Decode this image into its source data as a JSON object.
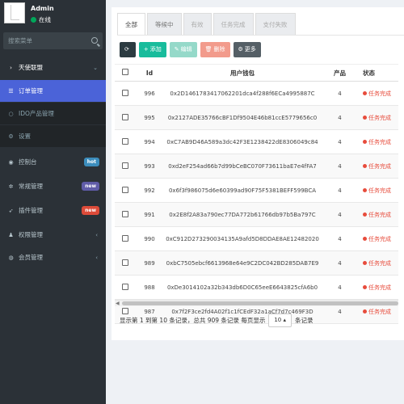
{
  "user": {
    "name": "Admin",
    "status": "在线"
  },
  "search": {
    "placeholder": "搜索菜单"
  },
  "menu": [
    {
      "label": "天使联盟",
      "icon": "chevron-right-icon",
      "type": "parent",
      "chevron": "⌄"
    },
    {
      "label": "订单管理",
      "icon": "list-icon",
      "type": "active"
    },
    {
      "label": "IDO产品管理",
      "icon": "circle-icon",
      "type": "sub"
    },
    {
      "label": "设置",
      "icon": "gear-icon",
      "type": "sub"
    },
    {
      "label": "控制台",
      "icon": "dashboard-icon",
      "badge": "hot",
      "badge_color": "#3c8dbc"
    },
    {
      "label": "常规管理",
      "icon": "cogs-icon",
      "badge": "new",
      "badge_color": "#605ca8"
    },
    {
      "label": "插件管理",
      "icon": "rocket-icon",
      "badge": "new",
      "badge_color": "#dd4b39"
    },
    {
      "label": "权限管理",
      "icon": "users-icon",
      "chevron": "‹"
    },
    {
      "label": "会员管理",
      "icon": "user-circle-icon",
      "chevron": "‹"
    }
  ],
  "tabs": [
    "全部",
    "等候中",
    "有效",
    "任务完成",
    "支付失败"
  ],
  "toolbar": {
    "refresh_label": "",
    "add_label": "添加",
    "edit_label": "编辑",
    "delete_label": "删除",
    "more_label": "更多"
  },
  "colors": {
    "refresh": "#2c3b41",
    "add": "#18bc9c",
    "edit": "#95d9c9",
    "delete": "#f29b8c",
    "more": "#555f66",
    "status_red": "#e74c3c"
  },
  "table": {
    "headers": [
      "Id",
      "用户钱包",
      "产品",
      "状态"
    ],
    "rows": [
      {
        "id": "996",
        "wallet": "0x2D1461783417062201dca4f288f6ECa4995887C",
        "product": "4",
        "status": "任务完成"
      },
      {
        "id": "995",
        "wallet": "0x2127ADE35766cBF1Df9504E46b81ccE5779656c0",
        "product": "4",
        "status": "任务完成"
      },
      {
        "id": "994",
        "wallet": "0xC7AB9D46A589a3dc42F3E1238422dE8306049c84",
        "product": "4",
        "status": "任务完成"
      },
      {
        "id": "993",
        "wallet": "0xd2eF254ad66b7d99bCeBC070F73611baE7e4fFA7",
        "product": "4",
        "status": "任务完成"
      },
      {
        "id": "992",
        "wallet": "0x6f3f986075d6e60399ad90F75F5381BEFF599BCA",
        "product": "4",
        "status": "任务完成"
      },
      {
        "id": "991",
        "wallet": "0x2E8f2A83a790ec77DA772b61766db97b5Ba797C",
        "product": "4",
        "status": "任务完成"
      },
      {
        "id": "990",
        "wallet": "0xC912D273290034135A9afd5D8DDAE8AE12482020",
        "product": "4",
        "status": "任务完成"
      },
      {
        "id": "989",
        "wallet": "0xbC7505ebcf6613968e64e9C2DC042BD285DAB7E9",
        "product": "4",
        "status": "任务完成"
      },
      {
        "id": "988",
        "wallet": "0xDe3014102a32b343db6D0C65eeE6643825cfA6b0",
        "product": "4",
        "status": "任务完成"
      },
      {
        "id": "987",
        "wallet": "0x7f2F3ce2fd4A02f1c1fCEdF32a1aCf7d7c469F3D",
        "product": "4",
        "status": "任务完成"
      }
    ]
  },
  "pager": {
    "text_before": "显示第 1 到第 10 条记录，总共 909 条记录 每页显示",
    "page_size": "10",
    "text_after": "条记录"
  }
}
